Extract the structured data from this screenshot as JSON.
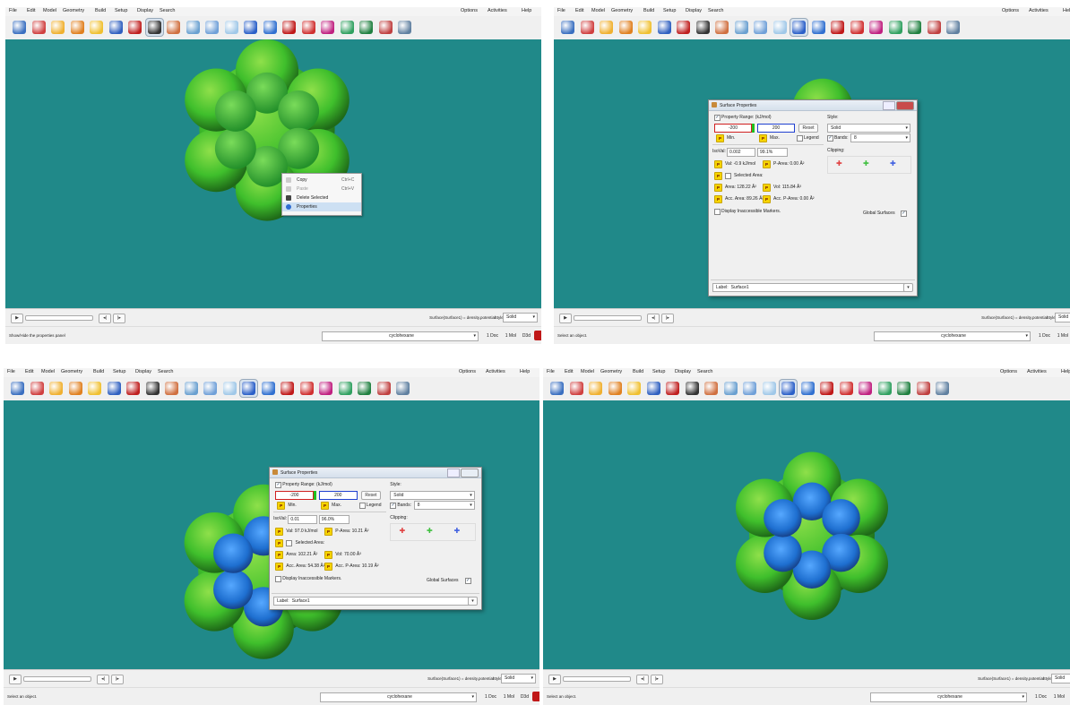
{
  "menu": {
    "left": [
      "File",
      "Edit",
      "Model",
      "Geometry",
      "Build",
      "Setup",
      "Display",
      "Search"
    ],
    "right": [
      "Options",
      "Activities",
      "Help"
    ]
  },
  "toolbar_icons": [
    "new-document-icon",
    "sketch-icon",
    "open-file-icon",
    "open-recent-icon",
    "save-icon",
    "undo-icon",
    "build-tool-icon",
    "view-glasses-icon",
    "calculations-icon",
    "guess-icon",
    "surfaces-icon",
    "spectra-icon",
    "properties-icon",
    "molecule-properties-icon",
    "orbitals-icon",
    "pie-plot-icon",
    "spectrum-peak-icon",
    "table-icon",
    "reactions-icon",
    "fragments-icon",
    "tasks-icon"
  ],
  "context_menu": {
    "items": [
      {
        "label": "Copy",
        "shortcut": "Ctrl+C"
      },
      {
        "label": "Paste",
        "shortcut": "Ctrl+V"
      },
      {
        "label": "Delete Selected",
        "shortcut": ""
      },
      {
        "label": "Properties",
        "shortcut": ""
      }
    ]
  },
  "view_bar": {
    "surface_info": "Surface(Surface1) = density,potential",
    "style_label": "Style:",
    "style_value": "Solid"
  },
  "status": {
    "p1_message": "Show/Hide the properties panel",
    "message": "Select an object.",
    "molecule": "cyclohexane",
    "doc_count": "1 Doc",
    "mol_count": "1 Mol",
    "view_mode": "D3d"
  },
  "dialog2": {
    "title": "Surface Properties",
    "property_range_label": "Property Range: (kJ/mol)",
    "min_value": "-200",
    "max_value": "200",
    "reset_label": "Reset",
    "min_label": "Min.",
    "max_label": "Max.",
    "legend_label": "Legend",
    "style_label": "Style:",
    "style_value": "Solid",
    "bands_label": "Bands:",
    "bands_value": "8",
    "isoval_label": "IsoVal:",
    "isoval_value": "0.002",
    "isoval_percent": "99.1%",
    "clipping_label": "Clipping:",
    "val": "Val: -0.9  kJ/mol",
    "parea": "P-Area: 0.00 Å²",
    "selected_area_label": "Selected Area:",
    "area": "Area: 128.22 Å²",
    "vol": "Vol: 115.84 Å³",
    "acc_area": "Acc. Area: 89.26 Å²",
    "acc_parea": "Acc. P-Area: 0.00 Å²",
    "inaccessible_label": "Display Inaccessible Markers.",
    "global_label": "Global Surfaces",
    "label_field": "Label:",
    "label_value": "Surface1"
  },
  "dialog3": {
    "title": "Surface Properties",
    "property_range_label": "Property Range: (kJ/mol)",
    "min_value": "-200",
    "max_value": "200",
    "reset_label": "Reset",
    "min_label": "Min.",
    "max_label": "Max.",
    "legend_label": "Legend",
    "style_label": "Style:",
    "style_value": "Solid",
    "bands_label": "Bands:",
    "bands_value": "8",
    "isoval_label": "IsoVal:",
    "isoval_value": "0.01",
    "isoval_percent": "96.0%",
    "clipping_label": "Clipping:",
    "val": "Val: 97.0  kJ/mol",
    "parea": "P-Area: 10.21 Å²",
    "selected_area_label": "Selected Area:",
    "area": "Area: 102.21 Å²",
    "vol": "Vol: 70.00 Å³",
    "acc_area": "Acc. Area: 54.38 Å²",
    "acc_parea": "Acc. P-Area: 10.19 Å²",
    "inaccessible_label": "Display Inaccessible Markers.",
    "global_label": "Global Surfaces",
    "label_field": "Label:",
    "label_value": "Surface1"
  },
  "colors": {
    "viewport": "#208989",
    "surface_green": "#3fbf2c",
    "blob_blue": "#1e6fd0"
  }
}
